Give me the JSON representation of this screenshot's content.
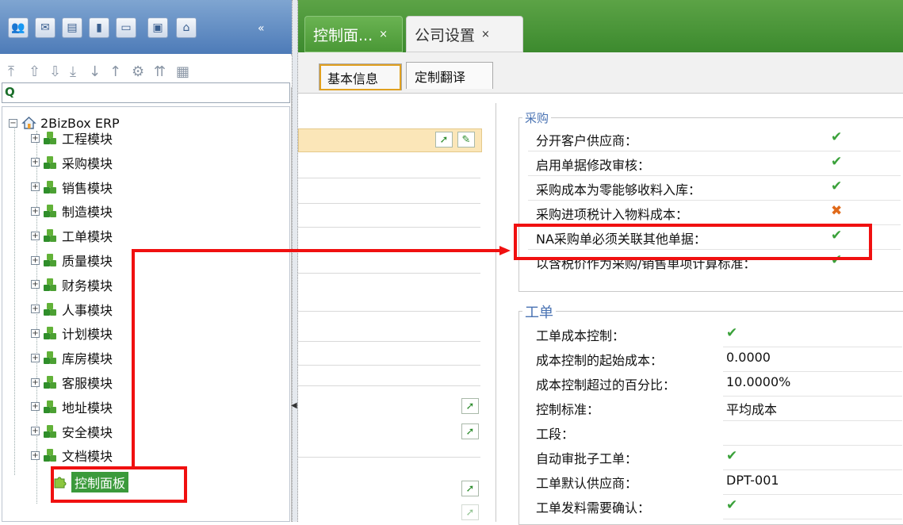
{
  "left_panel": {
    "collapse_glyph": "«",
    "tree": {
      "root_label": "2BizBox ERP",
      "modules": [
        "工程模块",
        "采购模块",
        "销售模块",
        "制造模块",
        "工单模块",
        "质量模块",
        "财务模块",
        "人事模块",
        "计划模块",
        "库房模块",
        "客服模块",
        "地址模块",
        "安全模块",
        "文档模块"
      ],
      "selected_label": "控制面板"
    }
  },
  "tabs": {
    "tab1": "控制面...",
    "tab2": "公司设置",
    "close": "×"
  },
  "subtabs": {
    "basic": "基本信息",
    "translate": "定制翻译"
  },
  "purchase": {
    "legend": "采购",
    "rows": [
      {
        "label": "分开客户供应商：",
        "value": "✔",
        "status": "check"
      },
      {
        "label": "启用单据修改审核：",
        "value": "✔",
        "status": "check"
      },
      {
        "label": "采购成本为零能够收料入库：",
        "value": "✔",
        "status": "check"
      },
      {
        "label": "采购进项税计入物料成本：",
        "value": "✖",
        "status": "cross"
      },
      {
        "label": "NA采购单必须关联其他单据：",
        "value": "✔",
        "status": "check"
      },
      {
        "label": "以含税价作为采购/销售单项计算标准：",
        "value": "✔",
        "status": "check"
      }
    ]
  },
  "workorder": {
    "legend": "工单",
    "rows": [
      {
        "label": "工单成本控制：",
        "value": "✔"
      },
      {
        "label": "成本控制的起始成本：",
        "value": "0.0000"
      },
      {
        "label": "成本控制超过的百分比：",
        "value": "10.0000%"
      },
      {
        "label": "控制标准：",
        "value": "平均成本"
      },
      {
        "label": "工段：",
        "value": ""
      },
      {
        "label": "自动审批子工单：",
        "value": "✔"
      },
      {
        "label": "工单默认供应商：",
        "value": "DPT-001"
      },
      {
        "label": "工单发料需要确认：",
        "value": "✔"
      }
    ]
  },
  "colors": {
    "accent_green": "#3c8a2e",
    "highlight_red": "#f01010",
    "check_green": "#3aa13a",
    "cross_orange": "#e06a1a"
  }
}
